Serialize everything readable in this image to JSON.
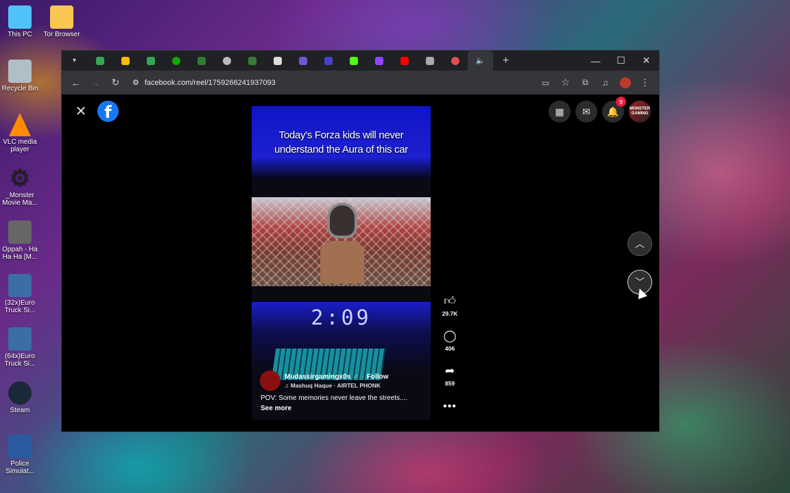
{
  "desktop": {
    "icons": [
      {
        "label": "This PC",
        "icon": "monitor-icon",
        "color": "#4fc3f7"
      },
      {
        "label": "Tor Browser",
        "icon": "folder-icon",
        "color": "#f9c74f"
      },
      {
        "label": "Recycle Bin",
        "icon": "recycle-bin-icon",
        "color": "#b0bec5"
      },
      {
        "label": "VLC media player",
        "icon": "vlc-cone-icon",
        "color": "#ff8c00"
      },
      {
        "label": "_Monster Movie Ma...",
        "icon": "gear-icon",
        "color": "#222222"
      },
      {
        "label": "Oppah - Ha Ha Ha [M...",
        "icon": "video-file-icon",
        "color": "#666666"
      },
      {
        "label": "(32x)Euro Truck Si...",
        "icon": "truck-icon",
        "color": "#3a6ea5"
      },
      {
        "label": "(64x)Euro Truck Si...",
        "icon": "truck-icon",
        "color": "#3a6ea5"
      },
      {
        "label": "Steam",
        "icon": "steam-icon",
        "color": "#1b2838"
      },
      {
        "label": "Police Simulat...",
        "icon": "police-icon",
        "color": "#2a5aa0"
      }
    ]
  },
  "browser": {
    "tabs": [
      {
        "icon": "google-drive-icon",
        "color": "#34a853"
      },
      {
        "icon": "google-drive-icon",
        "color": "#fbbc04"
      },
      {
        "icon": "google-drive-icon",
        "color": "#34a853"
      },
      {
        "icon": "upwork-icon",
        "color": "#14a800"
      },
      {
        "icon": "st-icon",
        "color": "#2e7d32"
      },
      {
        "icon": "github-icon",
        "color": "#bbbbbb"
      },
      {
        "icon": "tab-icon",
        "color": "#3a7a3a"
      },
      {
        "icon": "image-icon",
        "color": "#dddddd"
      },
      {
        "icon": "tab-icon",
        "color": "#6a5acd"
      },
      {
        "icon": "tab-icon",
        "color": "#4b3fd0"
      },
      {
        "icon": "kick-icon",
        "color": "#53fc18"
      },
      {
        "icon": "twitch-icon",
        "color": "#9146ff"
      },
      {
        "icon": "youtube-icon",
        "color": "#ff0000"
      },
      {
        "icon": "tab-icon",
        "color": "#aaaaaa"
      },
      {
        "icon": "tab-icon",
        "color": "#e05050"
      },
      {
        "icon": "speaker-icon",
        "color": "#cccccc"
      }
    ],
    "new_tab": "+",
    "url": "facebook.com/reel/1759266241937093"
  },
  "facebook": {
    "notification_count": "9",
    "avatar_text": "MONSTER GAMING",
    "reel": {
      "caption_line1": "Today's Forza kids will never",
      "caption_line2": "understand the Aura of this car",
      "timer": "2:09",
      "author": "Mudassirgamingx0s",
      "follow": "Follow",
      "music": "Mashuq Haque · AIRTEL PHONK",
      "description": "POV: Some memories never leave the streets....",
      "see_more": "See more"
    },
    "actions": {
      "likes": "29.7K",
      "comments": "406",
      "shares": "859"
    }
  }
}
